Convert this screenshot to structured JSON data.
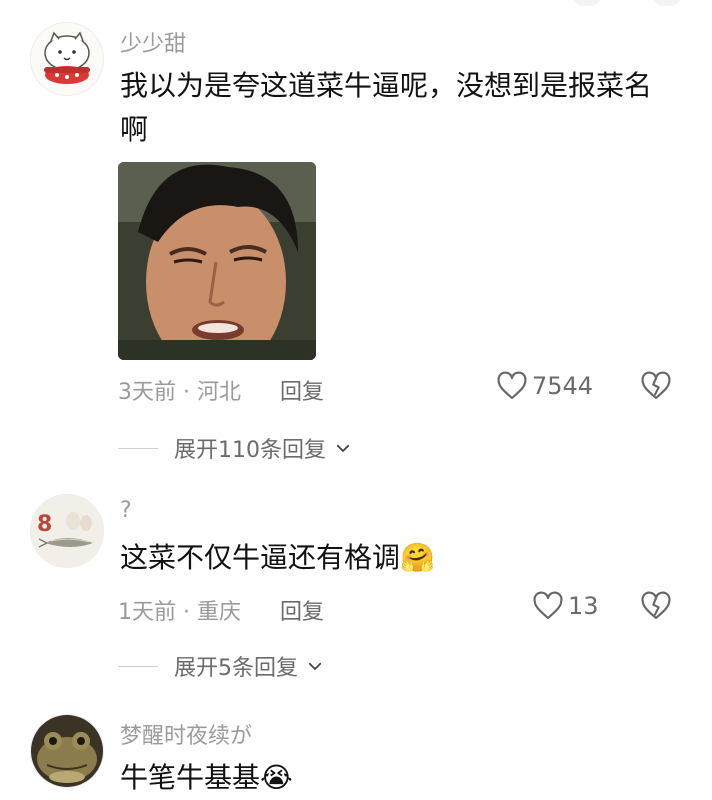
{
  "comments": [
    {
      "username": "少少甜",
      "text": "我以为是夸这道菜牛逼呢，没想到是报菜名啊",
      "time": "3天前",
      "location": "河北",
      "likes": "7544",
      "expand": "展开110条回复"
    },
    {
      "username": "?",
      "text": "这菜不仅牛逼还有格调",
      "emoji": "🤗",
      "time": "1天前",
      "location": "重庆",
      "likes": "13",
      "expand": "展开5条回复"
    },
    {
      "username": "梦醒时夜续が",
      "text": "牛笔牛基基",
      "emoji": "😭"
    }
  ],
  "ui": {
    "reply_label": "回复",
    "separator": "·"
  }
}
